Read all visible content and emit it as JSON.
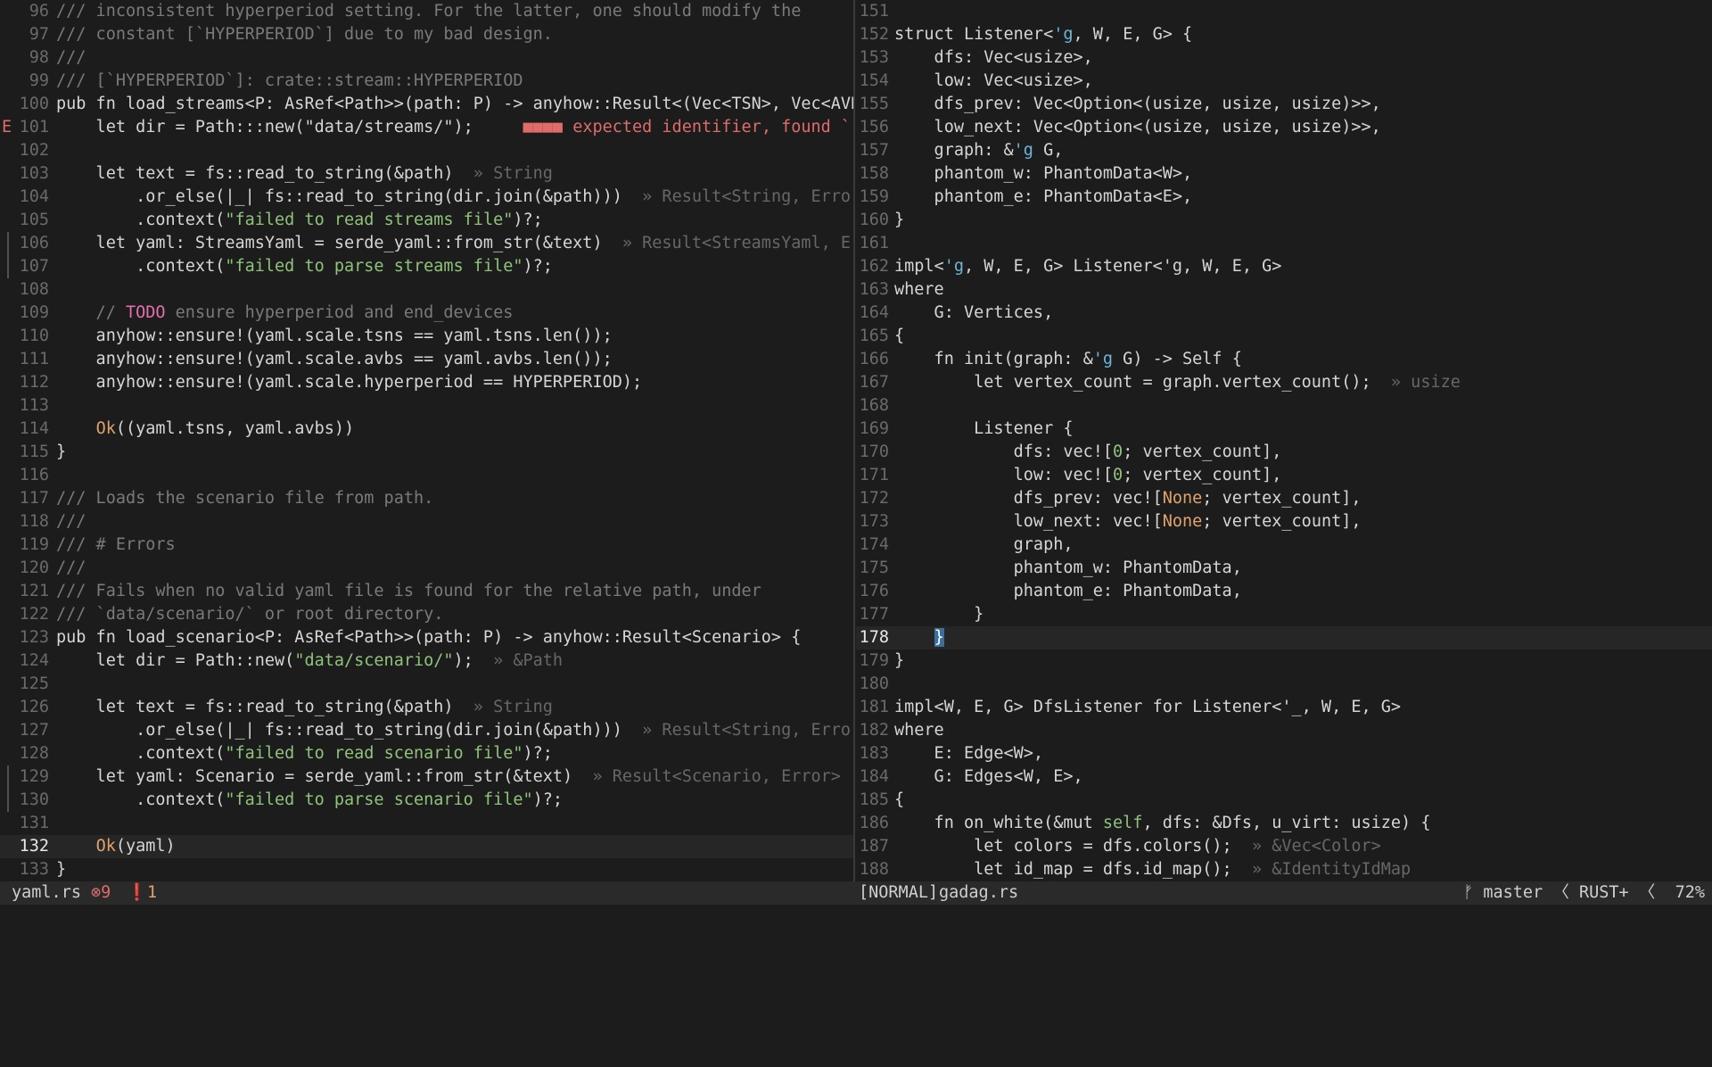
{
  "left_pane": {
    "lines": [
      {
        "n": "96",
        "t": "/// inconsistent hyperperiod setting. For the latter, one should modify the",
        "k": "cm"
      },
      {
        "n": "97",
        "t": "/// constant [`HYPERPERIOD`] due to my bad design.",
        "k": "cm"
      },
      {
        "n": "98",
        "t": "///",
        "k": "cm"
      },
      {
        "n": "99",
        "t": "/// [`HYPERPERIOD`]: crate::stream::HYPERPERIOD",
        "k": "cm"
      },
      {
        "n": "100",
        "t": "pub fn load_streams<P: AsRef<Path>>(path: P) -> anyhow::Result<(Vec<TSN>, Vec<AVB>)> {"
      },
      {
        "n": "101",
        "t": "    let dir = Path::",
        "err": "E",
        "diag": "     ■■■■ expected identifier, found `::`  exp",
        "rest": ":new(\"data/streams/\");",
        "errbefore": true
      },
      {
        "n": "102",
        "t": ""
      },
      {
        "n": "103",
        "t": "    let text = fs::read_to_string(&path)",
        "hint": "  » String"
      },
      {
        "n": "104",
        "t": "        .or_else(|_| fs::read_to_string(dir.join(&path)))",
        "hint": "  » Result<String, Error>"
      },
      {
        "n": "105",
        "t": "        .context(",
        "s": "\"failed to read streams file\"",
        "after": ")?;"
      },
      {
        "n": "106",
        "t": "    let yaml: StreamsYaml = serde_yaml::from_str(&text)",
        "hint": "  » Result<StreamsYaml, Error>",
        "chg": true
      },
      {
        "n": "107",
        "t": "        .context(",
        "s": "\"failed to parse streams file\"",
        "after": ")?;",
        "chg": true
      },
      {
        "n": "108",
        "t": ""
      },
      {
        "n": "109",
        "t": "    // ",
        "todo": "TODO",
        "after2": " ensure hyperperiod and end_devices",
        "k": "cm"
      },
      {
        "n": "110",
        "t": "    anyhow::ensure!(yaml.scale.tsns == yaml.tsns.len());"
      },
      {
        "n": "111",
        "t": "    anyhow::ensure!(yaml.scale.avbs == yaml.avbs.len());"
      },
      {
        "n": "112",
        "t": "    anyhow::ensure!(yaml.scale.hyperperiod == HYPERPERIOD);"
      },
      {
        "n": "113",
        "t": ""
      },
      {
        "n": "114",
        "t": "    ",
        "fnc": "Ok",
        "after": "((yaml.tsns, yaml.avbs))"
      },
      {
        "n": "115",
        "t": "}"
      },
      {
        "n": "116",
        "t": ""
      },
      {
        "n": "117",
        "t": "/// Loads the scenario file from path.",
        "k": "cm"
      },
      {
        "n": "118",
        "t": "///",
        "k": "cm"
      },
      {
        "n": "119",
        "t": "/// # Errors",
        "k": "cm"
      },
      {
        "n": "120",
        "t": "///",
        "k": "cm"
      },
      {
        "n": "121",
        "t": "/// Fails when no valid yaml file is found for the relative path, under",
        "k": "cm"
      },
      {
        "n": "122",
        "t": "/// `data/scenario/` or root directory.",
        "k": "cm"
      },
      {
        "n": "123",
        "t": "pub fn load_scenario<P: AsRef<Path>>(path: P) -> anyhow::Result<Scenario> {"
      },
      {
        "n": "124",
        "t": "    let dir = Path::new(",
        "s": "\"data/scenario/\"",
        "after": ");",
        "hint": "  » &Path"
      },
      {
        "n": "125",
        "t": ""
      },
      {
        "n": "126",
        "t": "    let text = fs::read_to_string(&path)",
        "hint": "  » String"
      },
      {
        "n": "127",
        "t": "        .or_else(|_| fs::read_to_string(dir.join(&path)))",
        "hint": "  » Result<String, Error>"
      },
      {
        "n": "128",
        "t": "        .context(",
        "s": "\"failed to read scenario file\"",
        "after": ")?;"
      },
      {
        "n": "129",
        "t": "    let yaml: Scenario = serde_yaml::from_str(&text)",
        "hint": "  » Result<Scenario, Error>",
        "chg": true
      },
      {
        "n": "130",
        "t": "        .context(",
        "s": "\"failed to parse scenario file\"",
        "after": ")?;",
        "chg": true
      },
      {
        "n": "131",
        "t": ""
      },
      {
        "n": "132",
        "t": "    ",
        "fnc": "Ok",
        "after": "(yaml)",
        "current": true
      },
      {
        "n": "133",
        "t": "}"
      }
    ]
  },
  "right_pane": {
    "lines": [
      {
        "n": "151",
        "t": ""
      },
      {
        "n": "152",
        "t": "struct Listener<",
        "lt": "'g",
        "after": ", W, E, G> {"
      },
      {
        "n": "153",
        "t": "    dfs: Vec<usize>,"
      },
      {
        "n": "154",
        "t": "    low: Vec<usize>,"
      },
      {
        "n": "155",
        "t": "    dfs_prev: Vec<Option<(usize, usize, usize)>>,"
      },
      {
        "n": "156",
        "t": "    low_next: Vec<Option<(usize, usize, usize)>>,"
      },
      {
        "n": "157",
        "t": "    graph: &",
        "lt": "'g",
        "after": " G,"
      },
      {
        "n": "158",
        "t": "    phantom_w: PhantomData<W>,"
      },
      {
        "n": "159",
        "t": "    phantom_e: PhantomData<E>,"
      },
      {
        "n": "160",
        "t": "}"
      },
      {
        "n": "161",
        "t": ""
      },
      {
        "n": "162",
        "t": "impl<",
        "lt": "'g",
        "after": ", W, E, G> Listener<'g, W, E, G>"
      },
      {
        "n": "163",
        "t": "where"
      },
      {
        "n": "164",
        "t": "    G: Vertices,"
      },
      {
        "n": "165",
        "t": "{"
      },
      {
        "n": "166",
        "t": "    fn init(graph: &",
        "lt": "'g",
        "after": " G) -> Self {"
      },
      {
        "n": "167",
        "t": "        let vertex_count = graph.vertex_count();",
        "hint": "  » usize"
      },
      {
        "n": "168",
        "t": ""
      },
      {
        "n": "169",
        "t": "        Listener {"
      },
      {
        "n": "170",
        "t": "            dfs: vec![",
        "num": "0",
        "after": "; vertex_count],"
      },
      {
        "n": "171",
        "t": "            low: vec![",
        "num": "0",
        "after": "; vertex_count],"
      },
      {
        "n": "172",
        "t": "            dfs_prev: vec![",
        "cst": "None",
        "after": "; vertex_count],"
      },
      {
        "n": "173",
        "t": "            low_next: vec![",
        "cst": "None",
        "after": "; vertex_count],"
      },
      {
        "n": "174",
        "t": "            graph,"
      },
      {
        "n": "175",
        "t": "            phantom_w: PhantomData,"
      },
      {
        "n": "176",
        "t": "            phantom_e: PhantomData,"
      },
      {
        "n": "177",
        "t": "        }"
      },
      {
        "n": "178",
        "t": "    ",
        "cursor": "}",
        "current": true
      },
      {
        "n": "179",
        "t": "}"
      },
      {
        "n": "180",
        "t": ""
      },
      {
        "n": "181",
        "t": "impl<W, E, G> DfsListener for Listener<'_, W, E, G>"
      },
      {
        "n": "182",
        "t": "where"
      },
      {
        "n": "183",
        "t": "    E: Edge<W>,"
      },
      {
        "n": "184",
        "t": "    G: Edges<W, E>,"
      },
      {
        "n": "185",
        "t": "{"
      },
      {
        "n": "186",
        "t": "    fn on_white(&mut ",
        "sf": "self",
        "after": ", dfs: &Dfs, u_virt: usize) {"
      },
      {
        "n": "187",
        "t": "        let colors = dfs.colors();",
        "hint": "  » &Vec<Color>"
      },
      {
        "n": "188",
        "t": "        let id_map = dfs.id_map();",
        "hint": "  » &IdentityIdMap"
      }
    ]
  },
  "statusline": {
    "left_file": "yaml.rs",
    "errors": "⊗9",
    "warnings": "❗1",
    "mode": "[NORMAL]",
    "right_file": "gadag.rs",
    "right_info": "ᚠ master 〈 RUST+ 〈  72%"
  },
  "colors": {
    "background": "#1c1c1c",
    "comment": "#7a7a7a",
    "string": "#8fc37a",
    "error": "#e06b6b",
    "constant": "#e0a36b",
    "lifetime": "#6fb6d8",
    "todo": "#e46fb0"
  }
}
